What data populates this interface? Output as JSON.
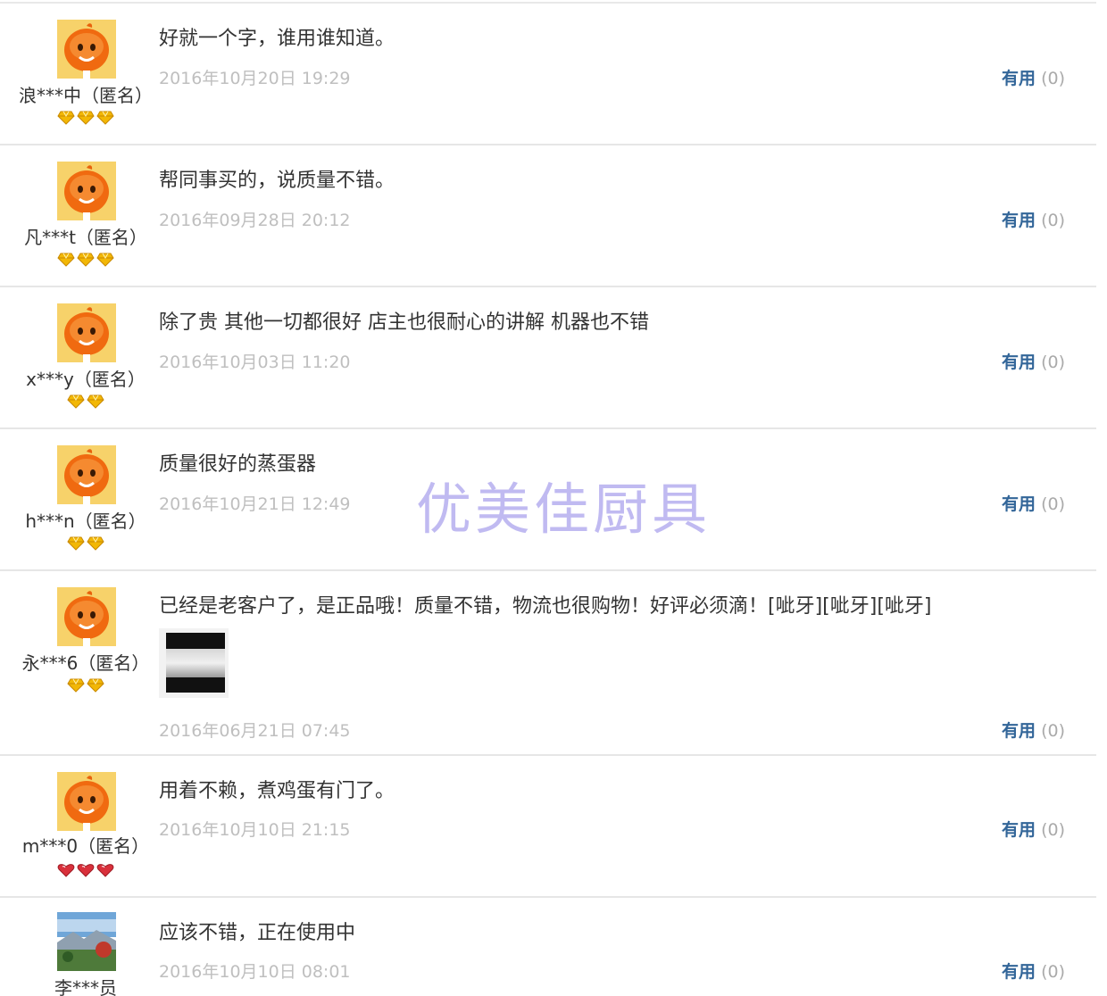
{
  "reviews": [
    {
      "user": "浪***中（匿名）",
      "avatar": "orange-mascot-icon",
      "badges": [
        "gold-diamond-icon",
        "gold-diamond-icon",
        "gold-diamond-icon"
      ],
      "comment": "好就一个字，谁用谁知道。",
      "date": "2016年10月20日 19:29",
      "useful_label": "有用",
      "useful_count": "(0)"
    },
    {
      "user": "凡***t（匿名）",
      "avatar": "orange-mascot-icon",
      "badges": [
        "gold-diamond-icon",
        "gold-diamond-icon",
        "gold-diamond-icon"
      ],
      "comment": "帮同事买的，说质量不错。",
      "date": "2016年09月28日 20:12",
      "useful_label": "有用",
      "useful_count": "(0)"
    },
    {
      "user": "x***y（匿名）",
      "avatar": "orange-mascot-icon",
      "badges": [
        "gold-diamond-icon",
        "gold-diamond-icon"
      ],
      "comment": "除了贵 其他一切都很好 店主也很耐心的讲解 机器也不错",
      "date": "2016年10月03日 11:20",
      "useful_label": "有用",
      "useful_count": "(0)"
    },
    {
      "user": "h***n（匿名）",
      "avatar": "orange-mascot-icon",
      "badges": [
        "gold-diamond-icon",
        "gold-diamond-icon"
      ],
      "comment": "质量很好的蒸蛋器",
      "date": "2016年10月21日 12:49",
      "useful_label": "有用",
      "useful_count": "(0)"
    },
    {
      "user": "永***6（匿名）",
      "avatar": "orange-mascot-icon",
      "badges": [
        "gold-diamond-icon",
        "gold-diamond-icon"
      ],
      "comment": "已经是老客户了，是正品哦！质量不错，物流也很购物！好评必须滴！[呲牙][呲牙][呲牙]",
      "has_photo": true,
      "date": "2016年06月21日 07:45",
      "useful_label": "有用",
      "useful_count": "(0)"
    },
    {
      "user": "m***0（匿名）",
      "avatar": "orange-mascot-icon",
      "badges": [
        "red-heart-icon",
        "red-heart-icon",
        "red-heart-icon"
      ],
      "comment": "用着不赖，煮鸡蛋有门了。",
      "date": "2016年10月10日 21:15",
      "useful_label": "有用",
      "useful_count": "(0)"
    },
    {
      "user": "李***员",
      "avatar": "landscape-photo-icon",
      "badges": [],
      "comment": "应该不错，正在使用中",
      "date": "2016年10月10日 08:01",
      "useful_label": "有用",
      "useful_count": "(0)"
    }
  ],
  "watermark": "优美佳厨具",
  "colors": {
    "gold": "#f2b705",
    "red": "#d9303b",
    "link": "#336699",
    "date": "#bfbfbf"
  }
}
